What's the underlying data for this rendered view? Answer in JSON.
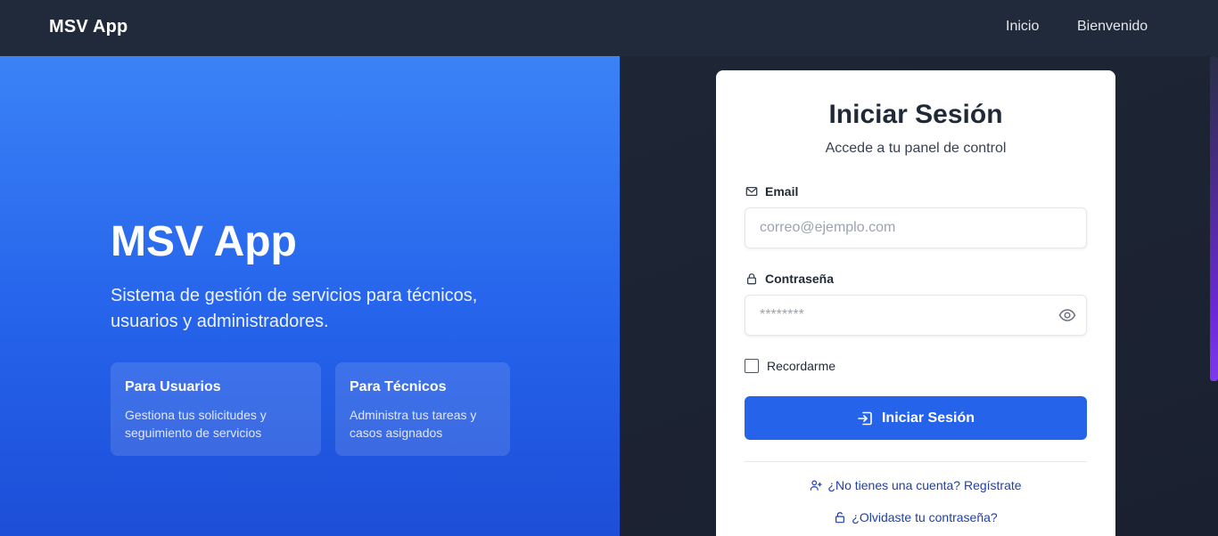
{
  "navbar": {
    "brand": "MSV App",
    "links": [
      "Inicio",
      "Bienvenido"
    ]
  },
  "hero": {
    "title": "MSV App",
    "subtitle": "Sistema de gestión de servicios para técnicos, usuarios y administradores.",
    "features": [
      {
        "title": "Para Usuarios",
        "description": "Gestiona tus solicitudes y seguimiento de servicios"
      },
      {
        "title": "Para Técnicos",
        "description": "Administra tus tareas y casos asignados"
      }
    ]
  },
  "login": {
    "title": "Iniciar Sesión",
    "subtitle": "Accede a tu panel de control",
    "email_label": "Email",
    "email_placeholder": "correo@ejemplo.com",
    "password_label": "Contraseña",
    "password_placeholder": "********",
    "remember_label": "Recordarme",
    "remember_checked": false,
    "submit_label": "Iniciar Sesión",
    "register_link": "¿No tienes una cuenta? Regístrate",
    "forgot_link": "¿Olvidaste tu contraseña?"
  },
  "icons": {
    "email": "mail-icon",
    "password": "lock-icon",
    "toggle_password": "eye-icon",
    "submit": "sign-in-icon",
    "register": "user-plus-icon",
    "forgot": "unlock-icon"
  },
  "colors": {
    "navbar_bg": "#212a3b",
    "hero_gradient_start": "#3b82f6",
    "hero_gradient_end": "#1d4ed8",
    "primary_button": "#2563eb",
    "link": "#1e40af"
  }
}
